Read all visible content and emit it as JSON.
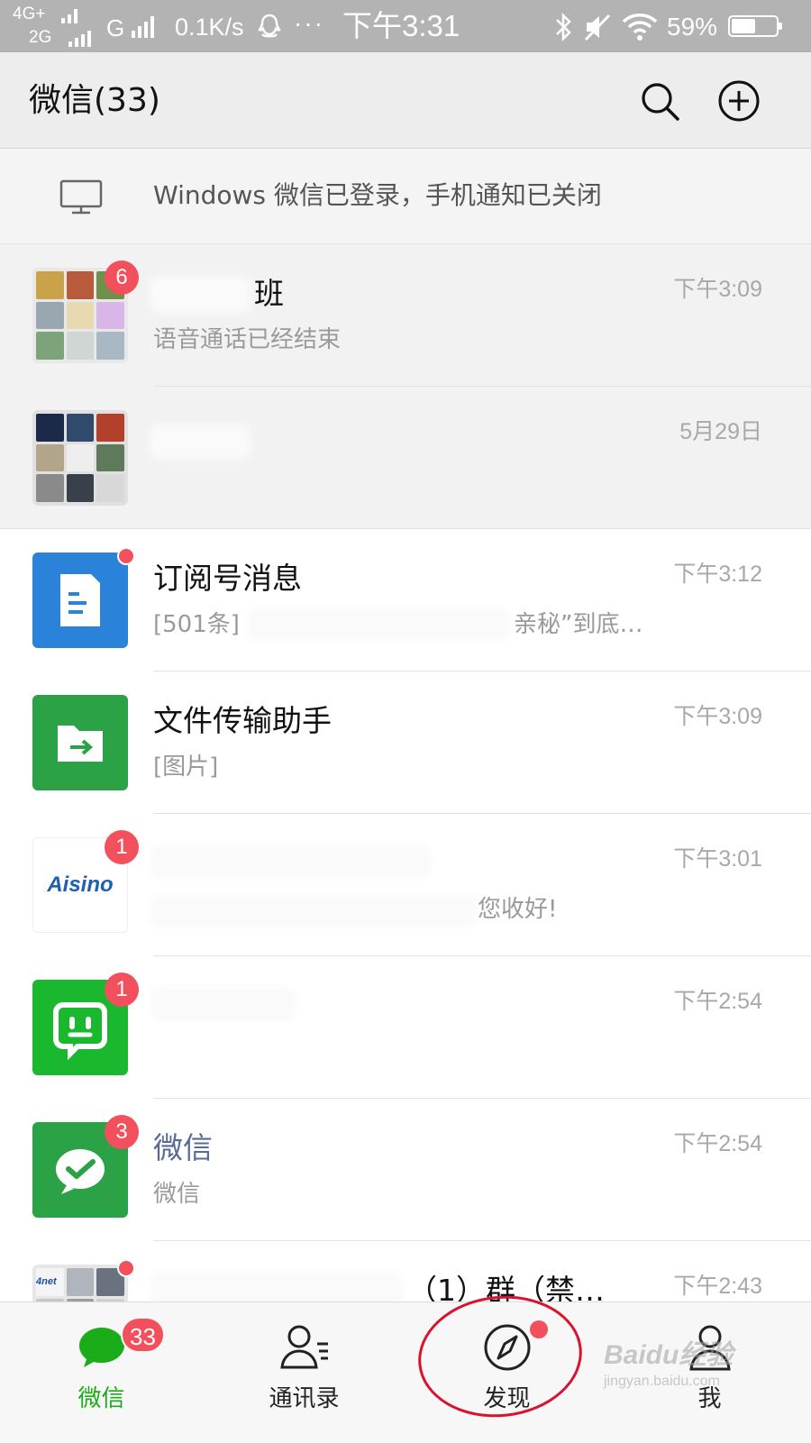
{
  "status_bar": {
    "network_line1": "4G+",
    "network_line2": "2G",
    "network3": "G",
    "speed": "0.1K/s",
    "dots": "···",
    "time": "下午3:31",
    "battery": "59%",
    "icons": [
      "signal-icon",
      "qq-icon",
      "bluetooth-icon",
      "mute-icon",
      "wifi-icon",
      "battery-icon"
    ]
  },
  "header": {
    "title": "微信(33)",
    "icons": [
      "search-icon",
      "plus-circle-icon"
    ]
  },
  "notice": {
    "text": "Windows 微信已登录，手机通知已关闭",
    "icon": "monitor-icon"
  },
  "chats": [
    {
      "name": "班",
      "message": "语音通话已经结束",
      "time": "下午3:09",
      "badge": "6",
      "pinned": true
    },
    {
      "name": "",
      "message": "",
      "time": "5月29日",
      "badge": "",
      "pinned": true
    },
    {
      "name": "订阅号消息",
      "message_prefix": "[501条]",
      "message_suffix": "亲秘”到底…",
      "time": "下午3:12",
      "dot": true
    },
    {
      "name": "文件传输助手",
      "message": "[图片]",
      "time": "下午3:09"
    },
    {
      "name": "",
      "logo_text": "Aisino",
      "message_suffix": "您收好!",
      "time": "下午3:01",
      "badge": "1"
    },
    {
      "name": "",
      "message": "",
      "time": "下午2:54",
      "badge": "1"
    },
    {
      "name": "微信",
      "message": "微信",
      "time": "下午2:54",
      "badge": "3"
    },
    {
      "name_suffix": "（1）群（禁…",
      "logo_text": "4net",
      "time": "下午2:43",
      "dot": true
    }
  ],
  "tabs": [
    {
      "label": "微信",
      "badge": "33",
      "active": true,
      "icon": "chat-bubble-icon"
    },
    {
      "label": "通讯录",
      "icon": "contacts-icon"
    },
    {
      "label": "发现",
      "dot": true,
      "icon": "compass-icon"
    },
    {
      "label": "我",
      "icon": "person-icon"
    }
  ],
  "colors": {
    "accent_green": "#1aad19",
    "badge_red": "#f1505c",
    "status_bar": "#b3b3b3",
    "header_bg": "#ededed",
    "annotation_red": "#d9122e"
  },
  "watermark": {
    "main": "Baidu经验",
    "sub": "jingyan.baidu.com"
  }
}
